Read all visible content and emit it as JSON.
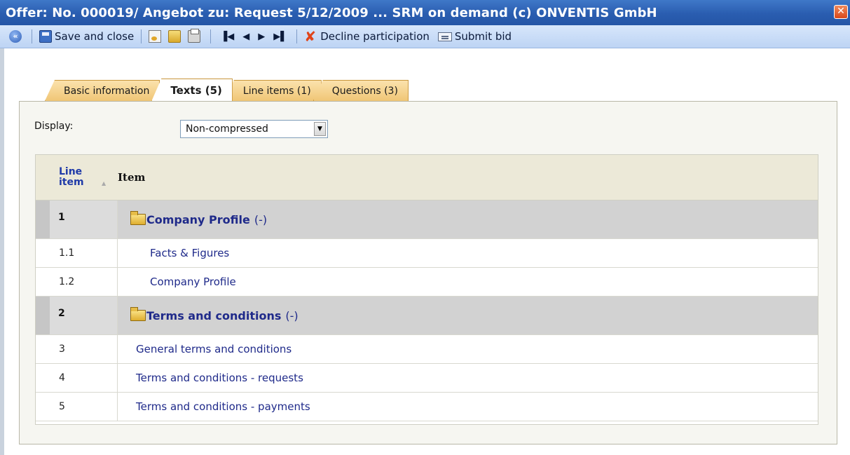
{
  "window": {
    "title": "Offer: No. 000019/ Angebot zu: Request 5/12/2009 ...  SRM on demand (c) ONVENTIS GmbH"
  },
  "toolbar": {
    "save_close_label": "Save and close",
    "decline_label": "Decline participation",
    "submit_label": "Submit bid",
    "icons": [
      "back-icon",
      "save-icon",
      "document-icon",
      "folder-icon",
      "print-icon",
      "first-icon",
      "previous-icon",
      "next-icon",
      "last-icon",
      "decline-icon",
      "submit-icon"
    ]
  },
  "tabs": [
    {
      "label": "Basic information",
      "active": false
    },
    {
      "label": "Texts (5)",
      "active": true
    },
    {
      "label": "Line items (1)",
      "active": false
    },
    {
      "label": "Questions (3)",
      "active": false
    }
  ],
  "filter": {
    "display_label": "Display:",
    "display_value": "Non-compressed"
  },
  "table": {
    "columns": [
      "Line item",
      "Item"
    ],
    "rows": [
      {
        "line": "1",
        "item": "Company Profile",
        "suffix": "(-)",
        "type": "group"
      },
      {
        "line": "1.1",
        "item": "Facts & Figures",
        "type": "sub"
      },
      {
        "line": "1.2",
        "item": "Company Profile",
        "type": "sub"
      },
      {
        "line": "2",
        "item": "Terms and conditions",
        "suffix": "(-)",
        "type": "group"
      },
      {
        "line": "3",
        "item": "General terms and conditions",
        "type": "top"
      },
      {
        "line": "4",
        "item": "Terms and conditions - requests",
        "type": "top"
      },
      {
        "line": "5",
        "item": "Terms and conditions - payments",
        "type": "top"
      }
    ]
  },
  "colors": {
    "title_bar": "#2a5db0",
    "toolbar": "#c9dcf7",
    "tab": "#f0c676",
    "link": "#1f2a8a",
    "group_row": "#d4d4d4"
  }
}
